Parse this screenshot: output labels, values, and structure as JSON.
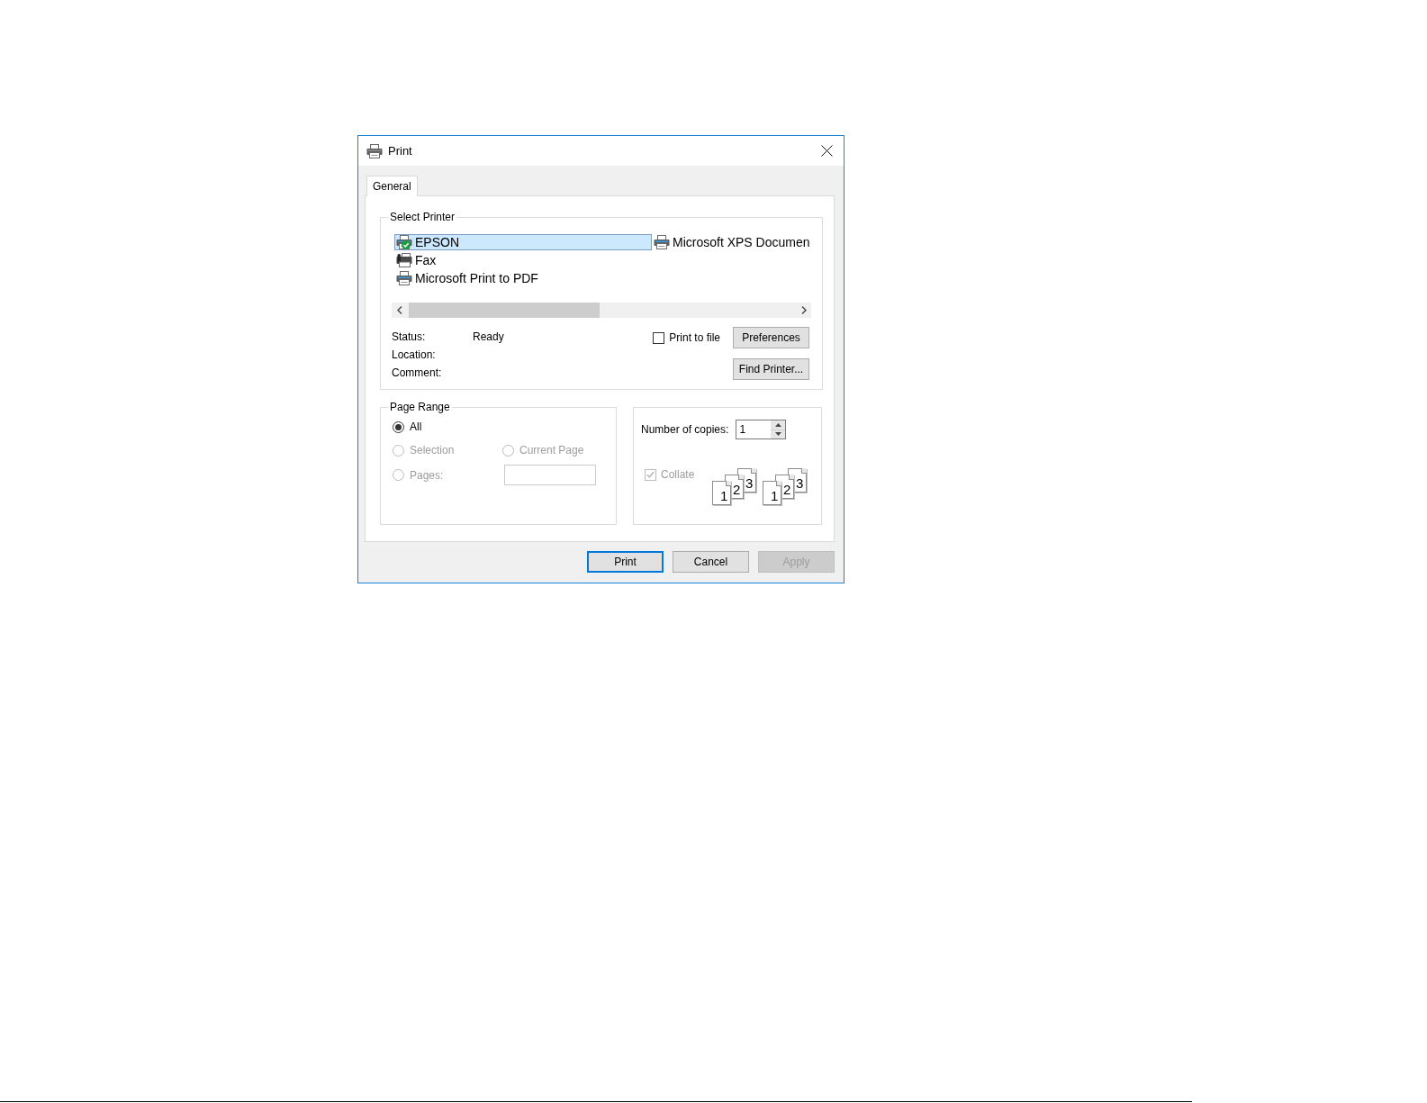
{
  "window": {
    "title": "Print"
  },
  "tabs": [
    {
      "label": "General",
      "selected": true
    }
  ],
  "select_printer": {
    "label": "Select Printer",
    "printers": [
      {
        "name": "EPSON",
        "kind": "printer",
        "default": true,
        "selected": true
      },
      {
        "name": "Fax",
        "kind": "fax",
        "default": false,
        "selected": false
      },
      {
        "name": "Microsoft Print to PDF",
        "kind": "printer",
        "default": false,
        "selected": false
      },
      {
        "name": "Microsoft XPS Documen",
        "kind": "printer",
        "default": false,
        "selected": false
      }
    ],
    "details": [
      {
        "label": "Status:",
        "value": "Ready"
      },
      {
        "label": "Location:"
      },
      {
        "label": "Comment:"
      }
    ],
    "print_to_file": {
      "label": "Print to file",
      "checked": false
    },
    "buttons": [
      {
        "label": "Preferences",
        "disabled": false
      },
      {
        "label": "Find Printer...",
        "disabled": false
      }
    ]
  },
  "page_range": {
    "label": "Page Range",
    "options": [
      {
        "label": "All",
        "selected": true,
        "disabled": false
      },
      {
        "label": "Selection",
        "selected": false,
        "disabled": true
      },
      {
        "label": "Current Page",
        "selected": false,
        "disabled": true
      },
      {
        "label": "Pages:",
        "selected": false,
        "disabled": true
      }
    ],
    "pages_field": {
      "disabled": true
    }
  },
  "copies": {
    "label": "Number of copies:",
    "value": "1",
    "collate": {
      "label": "Collate",
      "checked": true,
      "disabled": true
    },
    "collate_stacks": [
      {
        "pages": [
          "1",
          "2",
          "3"
        ]
      },
      {
        "pages": [
          "1",
          "2",
          "3"
        ]
      }
    ]
  },
  "buttons": [
    {
      "label": "Print",
      "default": true,
      "disabled": false
    },
    {
      "label": "Cancel",
      "default": false,
      "disabled": false
    },
    {
      "label": "Apply",
      "default": false,
      "disabled": true
    }
  ]
}
